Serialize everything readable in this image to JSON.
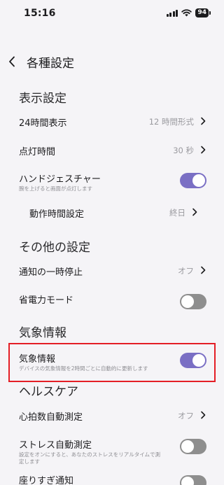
{
  "status_bar": {
    "time": "15:16",
    "battery": "94"
  },
  "header": {
    "title": "各種設定"
  },
  "sections": {
    "display": {
      "title": "表示設定",
      "time_format": {
        "label": "24時間表示",
        "value": "12 時間形式"
      },
      "light_time": {
        "label": "点灯時間",
        "value": "30 秒"
      },
      "hand_gesture": {
        "label": "ハンドジェスチャー",
        "sub": "腕を上げると画面が点灯します",
        "state": "on"
      },
      "active_time": {
        "label": "動作時間設定",
        "value": "終日"
      }
    },
    "other": {
      "title": "その他の設定",
      "notify_pause": {
        "label": "通知の一時停止",
        "value": "オフ"
      },
      "power_save": {
        "label": "省電力モード",
        "state": "off"
      }
    },
    "weather": {
      "title": "気象情報",
      "weather_info": {
        "label": "気象情報",
        "sub": "デバイスの気象情報を2時間ごとに自動的に更新します",
        "state": "on"
      }
    },
    "health": {
      "title": "ヘルスケア",
      "hr_auto": {
        "label": "心拍数自動測定",
        "value": "オフ"
      },
      "stress_auto": {
        "label": "ストレス自動測定",
        "sub1": "設定をオンにすると、あなたのストレスをリアルタイムで測",
        "sub2": "定します",
        "state": "off"
      },
      "sitting": {
        "label": "座りすぎ通知",
        "state": "off"
      }
    }
  },
  "colors": {
    "toggle_on": "#7a6fc4",
    "toggle_off": "#8e8e8e",
    "highlight": "#e41e26",
    "background": "#f5f4f7"
  }
}
